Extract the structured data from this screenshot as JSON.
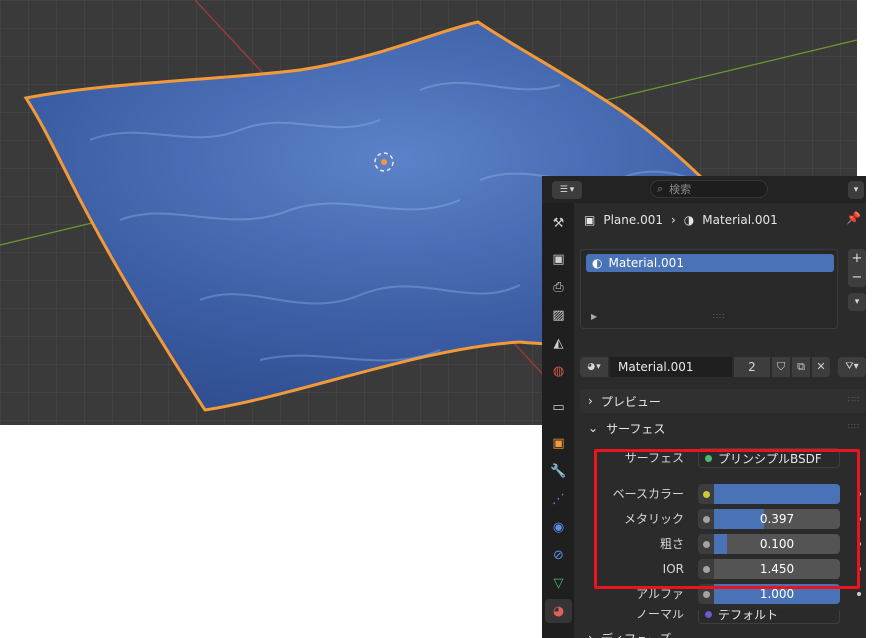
{
  "viewport": {
    "grid_color": "#3a3a3a",
    "mesh_color": "#3f63a8",
    "outline_color": "#f29a3a",
    "x_axis_color": "#a83b3b",
    "y_axis_color": "#6e9b2e"
  },
  "topbar": {
    "editor_icon": "properties-editor-icon",
    "search_placeholder": "検索"
  },
  "breadcrumb": {
    "object": "Plane.001",
    "material": "Material.001"
  },
  "material_slots": {
    "items": [
      {
        "label": "Material.001"
      }
    ],
    "add_symbol": "+",
    "remove_symbol": "−"
  },
  "datablock": {
    "name": "Material.001",
    "users": "2"
  },
  "sections": {
    "preview": "プレビュー",
    "surface": "サーフェス",
    "diffuse": "ディフューズ"
  },
  "surface": {
    "shader_label": "サーフェス",
    "shader_value": "プリンシプルBSDF"
  },
  "properties": [
    {
      "label": "ベースカラー",
      "socket": "#c9c93a",
      "value": "",
      "fill": 1.0,
      "color": "#4a72b6"
    },
    {
      "label": "メタリック",
      "socket": "#a3a3a3",
      "value": "0.397",
      "fill": 0.397
    },
    {
      "label": "粗さ",
      "socket": "#a3a3a3",
      "value": "0.100",
      "fill": 0.1
    },
    {
      "label": "IOR",
      "socket": "#a3a3a3",
      "value": "1.450",
      "fill": 0.0
    },
    {
      "label": "アルファ",
      "socket": "#a3a3a3",
      "value": "1.000",
      "fill": 1.0
    }
  ],
  "normal": {
    "label": "ノーマル",
    "value": "デフォルト",
    "socket": "#6b5cc7"
  },
  "highlight_color": "#e8141e"
}
